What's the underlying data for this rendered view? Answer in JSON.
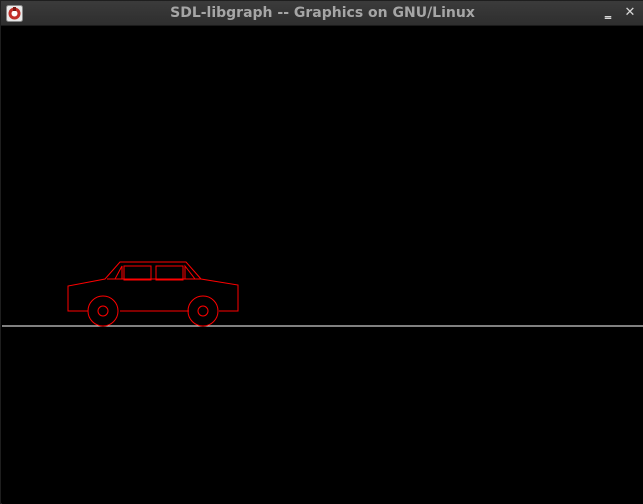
{
  "window": {
    "title": "SDL-libgraph -- Graphics on GNU/Linux",
    "minimize_glyph": "‗",
    "close_glyph": "✕",
    "icon": "sdl-app-icon"
  },
  "scene": {
    "background_color": "#000000",
    "ground_color": "#ffffff",
    "car_color": "#ff0000",
    "objects": [
      "ground-line",
      "car-outline"
    ]
  }
}
